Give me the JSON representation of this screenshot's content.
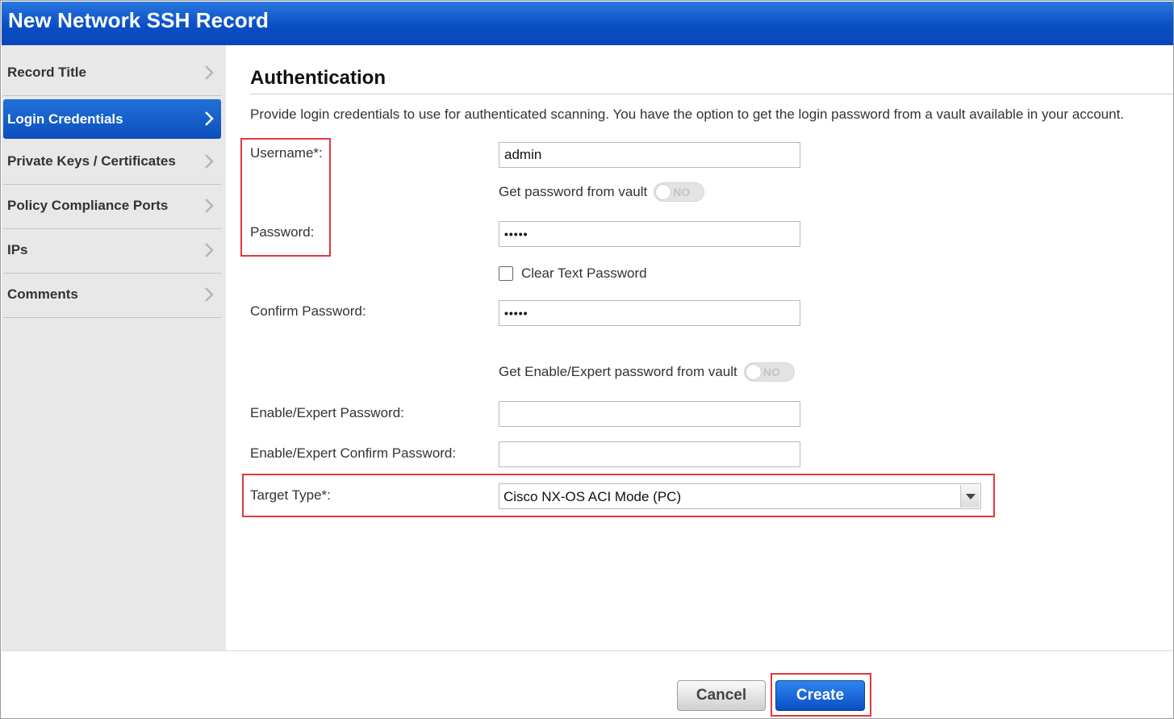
{
  "window": {
    "title": "New Network SSH Record"
  },
  "sidebar": {
    "items": [
      {
        "label": "Record Title",
        "active": false
      },
      {
        "label": "Login Credentials",
        "active": true
      },
      {
        "label": "Private Keys / Certificates",
        "active": false
      },
      {
        "label": "Policy Compliance Ports",
        "active": false
      },
      {
        "label": "IPs",
        "active": false
      },
      {
        "label": "Comments",
        "active": false
      }
    ]
  },
  "main": {
    "section_title": "Authentication",
    "description": "Provide login credentials to use for authenticated scanning. You have the option to get the login password from a vault available in your account.",
    "username": {
      "label": "Username*:",
      "value": "admin"
    },
    "password_vault": {
      "label": "Get password from vault",
      "toggle_text": "NO"
    },
    "password": {
      "label": "Password:",
      "value": "•••••"
    },
    "clear_text": {
      "label": "Clear Text Password",
      "checked": false
    },
    "confirm_password": {
      "label": "Confirm Password:",
      "value": "•••••"
    },
    "enable_vault": {
      "label": "Get Enable/Expert password from vault",
      "toggle_text": "NO"
    },
    "enable_password": {
      "label": "Enable/Expert Password:",
      "value": ""
    },
    "enable_confirm_password": {
      "label": "Enable/Expert Confirm Password:",
      "value": ""
    },
    "target_type": {
      "label": "Target Type*:",
      "value": "Cisco NX-OS ACI Mode (PC)"
    }
  },
  "footer": {
    "cancel_label": "Cancel",
    "create_label": "Create"
  },
  "colors": {
    "title_blue": "#0a4fc4",
    "highlight_red": "#e0393e",
    "sidebar_bg": "#e8e8e8"
  }
}
